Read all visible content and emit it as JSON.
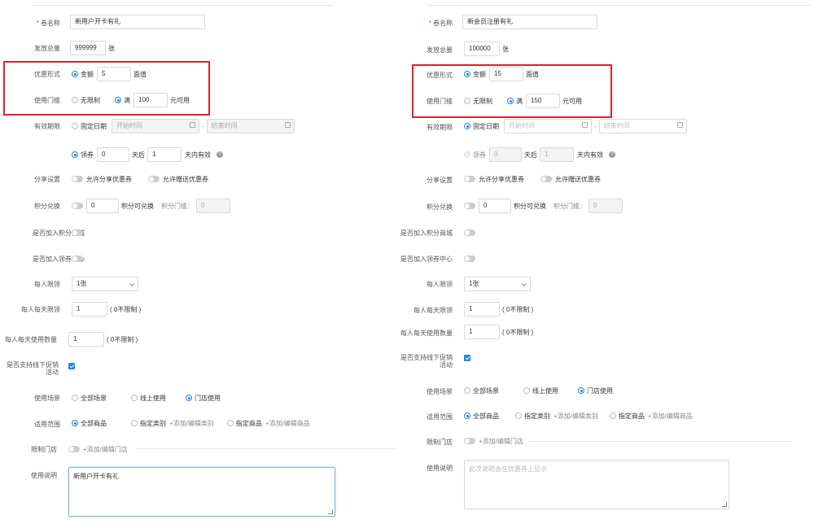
{
  "left": {
    "coupon_name_label": "卷名称",
    "coupon_name_value": "新用户开卡有礼",
    "total_label": "发放总量",
    "total_value": "999999",
    "total_unit": "张",
    "discount_label": "优惠形式",
    "discount_amount_radio": "金额",
    "discount_amount_value": "5",
    "discount_amount_unit": "面值",
    "threshold_label": "使用门槛",
    "threshold_none_radio": "无限制",
    "threshold_full_radio": "满",
    "threshold_full_value": "100",
    "threshold_full_unit": "元可用",
    "validity_label": "有效期限",
    "validity_fixed_radio": "固定日期",
    "validity_start_placeholder": "开始时间",
    "validity_dash": "-",
    "validity_end_placeholder": "结束时间",
    "validity_claim_radio": "领券",
    "validity_claim_days_value": "0",
    "validity_days_after": "天后",
    "validity_valid_days_value": "1",
    "validity_valid_days_unit": "天内有效",
    "share_label": "分享设置",
    "share_allow": "允许分享优惠券",
    "share_gift": "允许赠送优惠券",
    "points_label": "积分兑换",
    "points_value": "0",
    "points_unit": "积分可兑换",
    "points_threshold_label": "积分门槛：",
    "points_threshold_value": "0",
    "points_mall_label": "是否加入积分商城",
    "coupon_center_label": "是否加入领券中心",
    "per_person_label": "每人限领",
    "per_person_value": "1张",
    "per_day_label": "每人每天限领",
    "per_day_value": "1",
    "per_day_note": "( 0不限制 )",
    "per_day_use_label": "每人每天使用数量",
    "per_day_use_value": "1",
    "per_day_use_note": "( 0不限制 )",
    "offline_label_1": "是否支持线下促销",
    "offline_label_2": "活动",
    "scene_label": "使用场景",
    "scene_all": "全部场景",
    "scene_online": "线上使用",
    "scene_store": "门店使用",
    "range_label": "适用范围",
    "range_all": "全部商品",
    "range_category": "指定类别",
    "range_category_link": "+添加/编辑类别",
    "range_goods": "指定商品",
    "range_goods_link": "+添加/编辑商品",
    "store_label": "限制门店",
    "store_link": "+添加/编辑门店",
    "desc_label": "使用说明",
    "desc_value": "新用户开卡有礼"
  },
  "right": {
    "coupon_name_label": "卷名称",
    "coupon_name_value": "新会员注册有礼",
    "total_label": "发放总量",
    "total_value": "100000",
    "total_unit": "张",
    "discount_label": "优惠形式",
    "discount_amount_radio": "金额",
    "discount_amount_value": "15",
    "discount_amount_unit": "面值",
    "threshold_label": "使用门槛",
    "threshold_none_radio": "无限制",
    "threshold_full_radio": "满",
    "threshold_full_value": "150",
    "threshold_full_unit": "元可用",
    "validity_label": "有效期限",
    "validity_fixed_radio": "固定日期",
    "validity_start_placeholder": "开始时间",
    "validity_dash": "-",
    "validity_end_placeholder": "结束时间",
    "validity_claim_radio": "领券",
    "validity_claim_days_value": "0",
    "validity_days_after": "天后",
    "validity_valid_days_value": "1",
    "validity_valid_days_unit": "天内有效",
    "share_label": "分享设置",
    "share_allow": "允许分享优惠券",
    "share_gift": "允许赠送优惠券",
    "points_label": "积分兑换",
    "points_value": "0",
    "points_unit": "积分可兑换",
    "points_threshold_label": "积分门槛：",
    "points_threshold_value": "0",
    "points_mall_label": "是否加入积分商城",
    "coupon_center_label": "是否加入领券中心",
    "per_person_label": "每人限领",
    "per_person_value": "1张",
    "per_day_label": "每人每天限领",
    "per_day_value": "1",
    "per_day_note": "( 0不限制 )",
    "per_day_use_label": "每人每天使用数量",
    "per_day_use_value": "1",
    "per_day_use_note": "( 0不限制 )",
    "offline_label_1": "是否支持线下促销",
    "offline_label_2": "活动",
    "scene_label": "使用场景",
    "scene_all": "全部场景",
    "scene_online": "线上使用",
    "scene_store": "门店使用",
    "range_label": "适用范围",
    "range_all": "全部商品",
    "range_category": "指定类别",
    "range_category_link": "+添加/编辑类别",
    "range_goods": "指定商品",
    "range_goods_link": "+添加/编辑商品",
    "store_label": "限制门店",
    "store_link": "+添加/编辑门店",
    "desc_label": "使用说明",
    "desc_placeholder": "此次说明会在优惠券上显示"
  },
  "colors": {
    "accent": "#1e88e5",
    "highlight_box": "#d9232a"
  },
  "icons": [
    "calendar-icon",
    "help-icon",
    "chevron-down-icon",
    "checkbox-checked-icon",
    "resize-grip-icon"
  ]
}
